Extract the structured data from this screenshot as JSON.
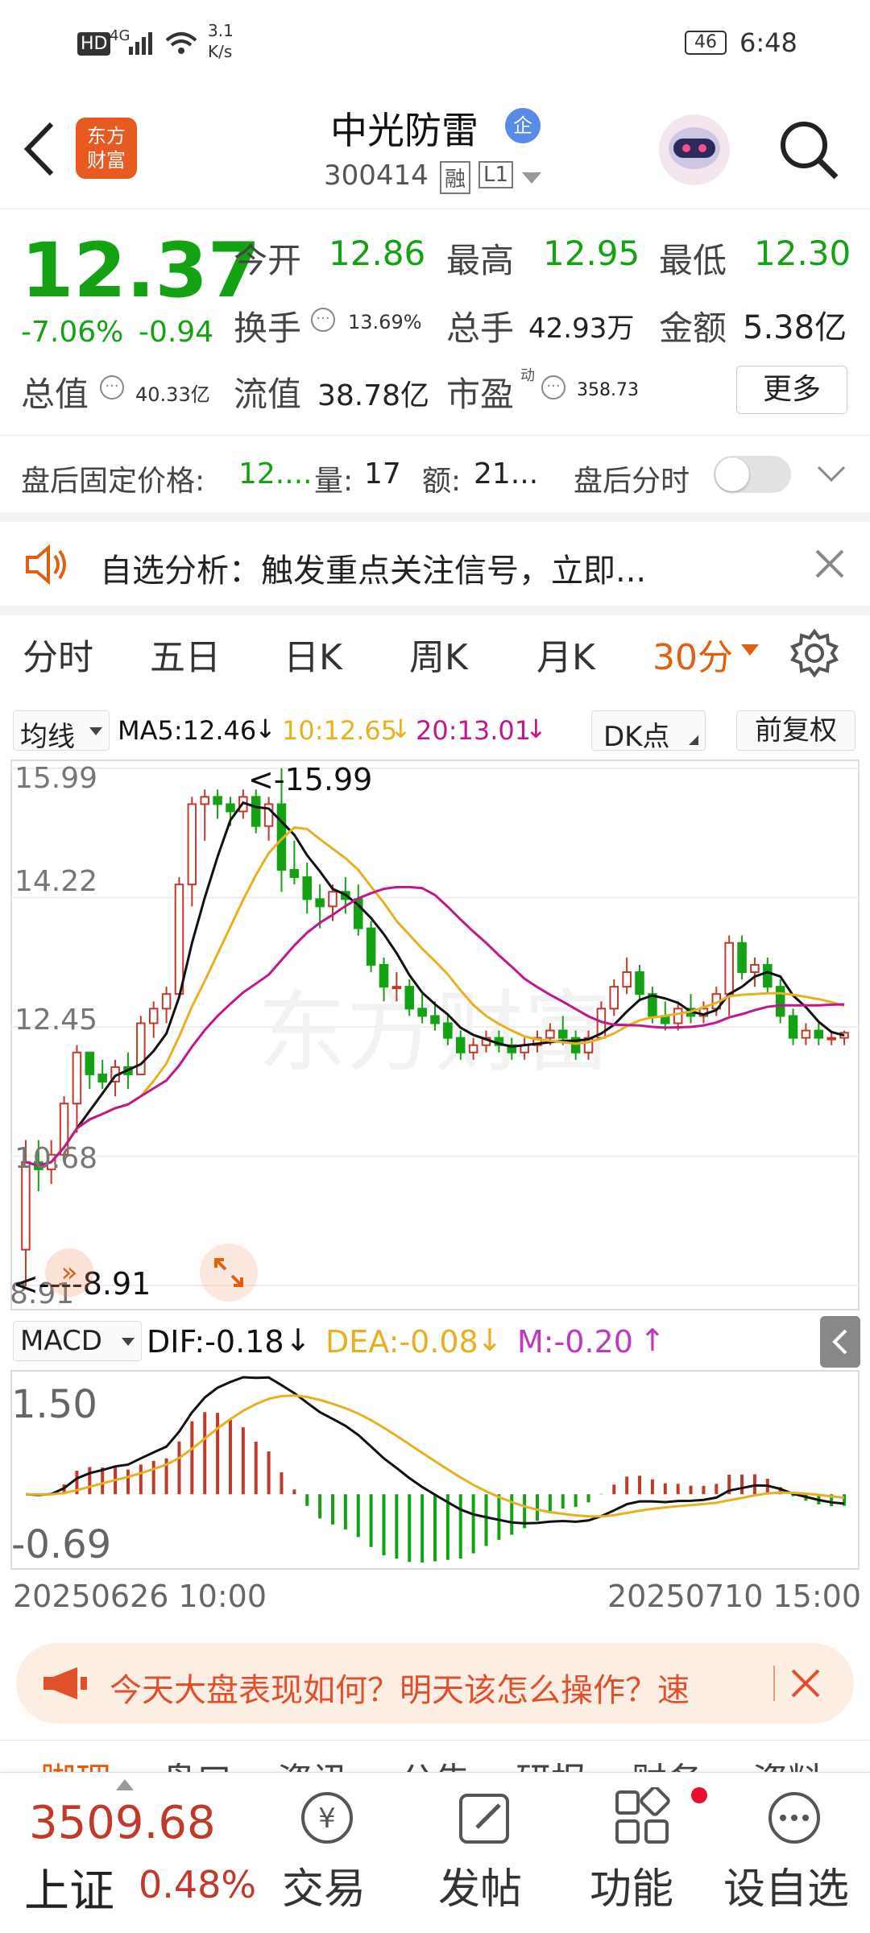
{
  "status": {
    "network": "HD",
    "signal": "4G",
    "speed_top": "3.1",
    "speed_bottom": "K/s",
    "battery": "46",
    "time": "6:48"
  },
  "header": {
    "title": "中光防雷",
    "badge": "企",
    "code": "300414",
    "tag1": "融",
    "tag2": "L1",
    "logo_line1": "东方",
    "logo_line2": "财富"
  },
  "quote": {
    "price": "12.37",
    "change_pct": "-7.06%",
    "change": "-0.94",
    "open_label": "今开",
    "open": "12.86",
    "high_label": "最高",
    "high": "12.95",
    "low_label": "最低",
    "low": "12.30",
    "turnover_label": "换手",
    "turnover": "13.69%",
    "volume_label": "总手",
    "volume": "42.93万",
    "amount_label": "金额",
    "amount": "5.38亿",
    "mktcap_label": "总值",
    "mktcap": "40.33亿",
    "float_label": "流值",
    "float": "38.78亿",
    "pe_label": "市盈",
    "pe_sup": "动",
    "pe": "358.73",
    "more": "更多"
  },
  "afterhours": {
    "price_label": "盘后固定价格:",
    "price": "12....",
    "qty_label": "量:",
    "qty": "17",
    "amt_label": "额:",
    "amt": "21...",
    "toggle_label": "盘后分时"
  },
  "notice": {
    "text": "自选分析：触发重点关注信号，立即..."
  },
  "tabs": [
    "分时",
    "五日",
    "日K",
    "周K",
    "月K",
    "30分"
  ],
  "ma": {
    "selector": "均线",
    "ma5": "MA5:12.46",
    "ma5_arrow": "↓",
    "ma10": "10:12.65",
    "ma10_arrow": "↓",
    "ma20": "20:13.01",
    "ma20_arrow": "↓",
    "dk": "DK点",
    "fq": "前复权"
  },
  "price_axis": [
    "15.99",
    "14.22",
    "12.45",
    "10.68",
    "8.91"
  ],
  "annotations": {
    "high": "<-15.99",
    "low": "<----8.91"
  },
  "macd": {
    "selector": "MACD",
    "dif": "DIF:-0.18",
    "dif_arrow": "↓",
    "dea": "DEA:-0.08",
    "dea_arrow": "↓",
    "m": "M:-0.20",
    "m_arrow": "↑",
    "axis_top": "1.50",
    "axis_bottom": "-0.69"
  },
  "time_axis": {
    "start": "20250626 10:00",
    "end": "20250710 15:00"
  },
  "banner": {
    "text": "今天大盘表现如何？明天该怎么操作？速"
  },
  "subtabs": [
    "脚理",
    "盘口",
    "资讯",
    "公告",
    "研报",
    "财务",
    "资料"
  ],
  "bottom": {
    "index_value": "3509.68",
    "index_name": "上证",
    "index_pct": "0.48%",
    "trade": "交易",
    "post": "发帖",
    "func": "功能",
    "watch": "设自选"
  },
  "colors": {
    "up": "#c0392b",
    "down": "#14a214",
    "accent": "#e06010",
    "ma5": "#111111",
    "ma10": "#e8b020",
    "ma20": "#c0188a"
  },
  "chart_data": {
    "type": "candlestick",
    "title": "30分",
    "ylim": [
      8.91,
      15.99
    ],
    "y_ticks": [
      15.99,
      14.22,
      12.45,
      10.68,
      8.91
    ],
    "x_range": [
      "20250626 10:00",
      "20250710 15:00"
    ],
    "candles": [
      [
        9.4,
        10.9,
        8.9,
        10.6
      ],
      [
        10.6,
        10.9,
        10.2,
        10.5
      ],
      [
        10.5,
        10.9,
        10.3,
        10.7
      ],
      [
        10.7,
        11.5,
        10.6,
        11.4
      ],
      [
        11.4,
        12.2,
        11.0,
        12.1
      ],
      [
        12.1,
        12.1,
        11.6,
        11.8
      ],
      [
        11.8,
        12.0,
        11.6,
        11.7
      ],
      [
        11.7,
        12.0,
        11.5,
        11.9
      ],
      [
        11.9,
        12.1,
        11.6,
        11.8
      ],
      [
        11.8,
        12.6,
        11.8,
        12.5
      ],
      [
        12.5,
        12.8,
        12.3,
        12.7
      ],
      [
        12.7,
        13.0,
        12.5,
        12.9
      ],
      [
        12.9,
        14.5,
        12.9,
        14.4
      ],
      [
        14.4,
        15.6,
        14.1,
        15.5
      ],
      [
        15.5,
        15.7,
        15.0,
        15.6
      ],
      [
        15.6,
        15.7,
        15.3,
        15.5
      ],
      [
        15.5,
        15.6,
        15.2,
        15.4
      ],
      [
        15.4,
        15.7,
        15.3,
        15.6
      ],
      [
        15.6,
        15.7,
        15.1,
        15.2
      ],
      [
        15.2,
        15.6,
        15.0,
        15.5
      ],
      [
        15.5,
        15.99,
        14.3,
        14.6
      ],
      [
        14.6,
        15.0,
        14.4,
        14.5
      ],
      [
        14.5,
        14.7,
        14.0,
        14.2
      ],
      [
        14.2,
        14.4,
        13.8,
        14.1
      ],
      [
        14.1,
        14.4,
        13.9,
        14.3
      ],
      [
        14.3,
        14.5,
        14.0,
        14.2
      ],
      [
        14.2,
        14.4,
        13.7,
        13.8
      ],
      [
        13.8,
        13.9,
        13.2,
        13.3
      ],
      [
        13.3,
        13.4,
        12.8,
        13.0
      ],
      [
        13.0,
        13.2,
        12.8,
        13.0
      ],
      [
        13.0,
        13.1,
        12.6,
        12.7
      ],
      [
        12.7,
        12.9,
        12.5,
        12.6
      ],
      [
        12.6,
        12.8,
        12.4,
        12.5
      ],
      [
        12.5,
        12.6,
        12.2,
        12.3
      ],
      [
        12.3,
        12.4,
        12.0,
        12.1
      ],
      [
        12.1,
        12.3,
        12.0,
        12.2
      ],
      [
        12.2,
        12.4,
        12.1,
        12.3
      ],
      [
        12.3,
        12.4,
        12.1,
        12.2
      ],
      [
        12.2,
        12.3,
        12.0,
        12.1
      ],
      [
        12.1,
        12.3,
        12.0,
        12.2
      ],
      [
        12.2,
        12.4,
        12.1,
        12.3
      ],
      [
        12.3,
        12.5,
        12.2,
        12.4
      ],
      [
        12.4,
        12.6,
        12.2,
        12.3
      ],
      [
        12.3,
        12.4,
        12.0,
        12.1
      ],
      [
        12.1,
        12.4,
        12.0,
        12.3
      ],
      [
        12.3,
        12.8,
        12.3,
        12.7
      ],
      [
        12.7,
        13.1,
        12.6,
        13.0
      ],
      [
        13.0,
        13.4,
        12.9,
        13.2
      ],
      [
        13.2,
        13.3,
        12.8,
        12.9
      ],
      [
        12.9,
        13.0,
        12.5,
        12.6
      ],
      [
        12.6,
        12.8,
        12.4,
        12.5
      ],
      [
        12.5,
        12.8,
        12.4,
        12.7
      ],
      [
        12.7,
        12.9,
        12.5,
        12.6
      ],
      [
        12.6,
        12.8,
        12.5,
        12.7
      ],
      [
        12.7,
        13.0,
        12.6,
        12.9
      ],
      [
        12.9,
        13.7,
        12.6,
        13.6
      ],
      [
        13.6,
        13.7,
        13.1,
        13.2
      ],
      [
        13.2,
        13.4,
        13.0,
        13.3
      ],
      [
        13.3,
        13.4,
        12.9,
        13.0
      ],
      [
        13.0,
        13.1,
        12.5,
        12.6
      ],
      [
        12.6,
        12.7,
        12.2,
        12.3
      ],
      [
        12.3,
        12.5,
        12.2,
        12.4
      ],
      [
        12.4,
        12.5,
        12.2,
        12.3
      ],
      [
        12.3,
        12.4,
        12.2,
        12.3
      ],
      [
        12.3,
        12.4,
        12.2,
        12.37
      ]
    ],
    "series": [
      {
        "name": "MA5",
        "value": 12.46
      },
      {
        "name": "MA10",
        "value": 12.65
      },
      {
        "name": "MA20",
        "value": 13.01
      }
    ]
  }
}
